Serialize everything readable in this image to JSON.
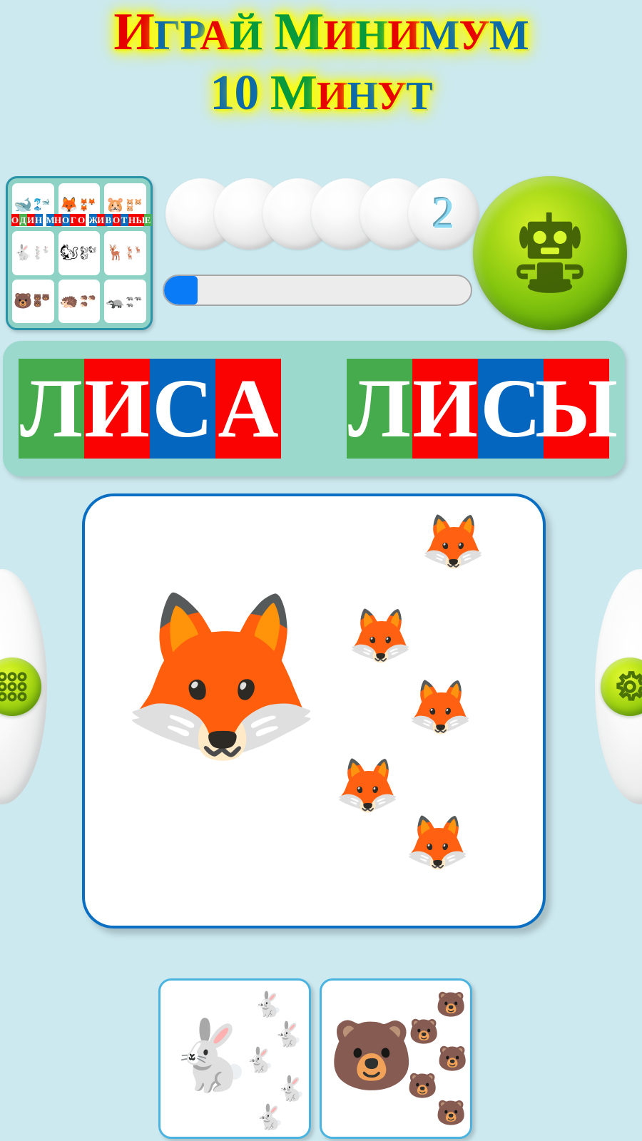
{
  "background_color": "#cce9ef",
  "title": {
    "line1": "Играй Минимум",
    "line2": "10 Минут",
    "glow_color": "#ffff00",
    "line1_letters": [
      {
        "ch": "И",
        "color": "red",
        "cap": true
      },
      {
        "ch": "Г",
        "color": "blue",
        "cap": false
      },
      {
        "ch": "Р",
        "color": "blue",
        "cap": false
      },
      {
        "ch": "А",
        "color": "red",
        "cap": false
      },
      {
        "ch": "Й",
        "color": "green",
        "cap": false
      },
      {
        "ch": " ",
        "color": "red",
        "cap": false
      },
      {
        "ch": "М",
        "color": "green",
        "cap": true
      },
      {
        "ch": "И",
        "color": "red",
        "cap": false
      },
      {
        "ch": "Н",
        "color": "green",
        "cap": false
      },
      {
        "ch": "И",
        "color": "red",
        "cap": false
      },
      {
        "ch": "М",
        "color": "blue",
        "cap": false
      },
      {
        "ch": "У",
        "color": "red",
        "cap": false
      },
      {
        "ch": "М",
        "color": "blue",
        "cap": false
      }
    ],
    "line2_letters": [
      {
        "ch": "1",
        "color": "blue",
        "cap": true
      },
      {
        "ch": "0",
        "color": "blue",
        "cap": true
      },
      {
        "ch": " ",
        "color": "blue",
        "cap": true
      },
      {
        "ch": "М",
        "color": "green",
        "cap": true
      },
      {
        "ch": "И",
        "color": "red",
        "cap": false
      },
      {
        "ch": "Н",
        "color": "blue",
        "cap": false
      },
      {
        "ch": "У",
        "color": "red",
        "cap": false
      },
      {
        "ch": "Т",
        "color": "blue",
        "cap": false
      }
    ]
  },
  "thumbnail_panel": {
    "panel_color": "#8ed2c6",
    "border_color": "#2a93a8",
    "overlay_words": [
      {
        "word": "ОДИН",
        "letters": [
          {
            "ch": "О",
            "bg": "r"
          },
          {
            "ch": "Д",
            "bg": "g"
          },
          {
            "ch": "И",
            "bg": "r"
          },
          {
            "ch": "Н",
            "bg": "b"
          }
        ]
      },
      {
        "word": "МНОГО",
        "letters": [
          {
            "ch": "М",
            "bg": "b"
          },
          {
            "ch": "Н",
            "bg": "r"
          },
          {
            "ch": "О",
            "bg": "b"
          },
          {
            "ch": "Г",
            "bg": "r"
          },
          {
            "ch": "О",
            "bg": "r"
          }
        ]
      },
      {
        "word": "ЖИВОТНЫЕ",
        "letters": [
          {
            "ch": "Ж",
            "bg": "b"
          },
          {
            "ch": "И",
            "bg": "r"
          },
          {
            "ch": "В",
            "bg": "b"
          },
          {
            "ch": "О",
            "bg": "r"
          },
          {
            "ch": "Т",
            "bg": "b"
          },
          {
            "ch": "Н",
            "bg": "r"
          },
          {
            "ch": "Ы",
            "bg": "r"
          },
          {
            "ch": "Е",
            "bg": "g"
          }
        ]
      }
    ],
    "cells": [
      {
        "name": "orca-whale-card",
        "big": "🐋",
        "smalls": "🐬🐋🐟"
      },
      {
        "name": "fox-card",
        "big": "🦊",
        "smalls": "🦊🦊🦊"
      },
      {
        "name": "hamster-card",
        "big": "🐹",
        "smalls": "🐹🐹🐹"
      },
      {
        "name": "rabbit-card",
        "big": "🐇",
        "smalls": "🐇🐇🐇"
      },
      {
        "name": "squirrel-card",
        "big": "🐿",
        "smalls": "🐿🐿🐿"
      },
      {
        "name": "deer-card",
        "big": "🦌",
        "smalls": "🦌🦌🦌"
      },
      {
        "name": "bear-card",
        "big": "🐻",
        "smalls": "🐻🐻🐻"
      },
      {
        "name": "hedgehog-card",
        "big": "🦔",
        "smalls": "🦔🦔🦔"
      },
      {
        "name": "badger-card",
        "big": "🦡",
        "smalls": "🦡🦡🦡"
      }
    ]
  },
  "counter": {
    "pearl_count": 6,
    "value": "2",
    "value_color": "#8ed9f2"
  },
  "progress": {
    "percent": 11,
    "fill_color": "#0a7bf7",
    "track_color": "#ececec"
  },
  "robot_button": {
    "icon": "robot-icon",
    "color": "#9ed111"
  },
  "word_bar": {
    "bar_color": "#9cd9cd",
    "words": [
      {
        "text": "ЛИСА",
        "letters": [
          {
            "ch": "Л",
            "bg": "g"
          },
          {
            "ch": "И",
            "bg": "r"
          },
          {
            "ch": "С",
            "bg": "b"
          },
          {
            "ch": "А",
            "bg": "r"
          }
        ]
      },
      {
        "text": "ЛИСЫ",
        "letters": [
          {
            "ch": "Л",
            "bg": "g"
          },
          {
            "ch": "И",
            "bg": "r"
          },
          {
            "ch": "С",
            "bg": "b"
          },
          {
            "ch": "Ы",
            "bg": "r"
          }
        ]
      }
    ]
  },
  "main_card": {
    "border_color": "#0a6fc2",
    "big_animal": "🦊",
    "small_animal": "🦊",
    "small_count": 5,
    "animal_name": "fox"
  },
  "side_buttons": {
    "left": {
      "icon": "grid-menu-icon",
      "color": "#9ed111"
    },
    "right": {
      "icon": "gear-icon",
      "color": "#9ed111"
    }
  },
  "answer_cards": [
    {
      "name": "rabbit-answer",
      "big": "🐇",
      "small": "🐇",
      "small_count": 5,
      "border": "#4ab3e0"
    },
    {
      "name": "bear-answer",
      "big": "🐻",
      "small": "🐻",
      "small_count": 5,
      "border": "#4ab3e0"
    }
  ]
}
